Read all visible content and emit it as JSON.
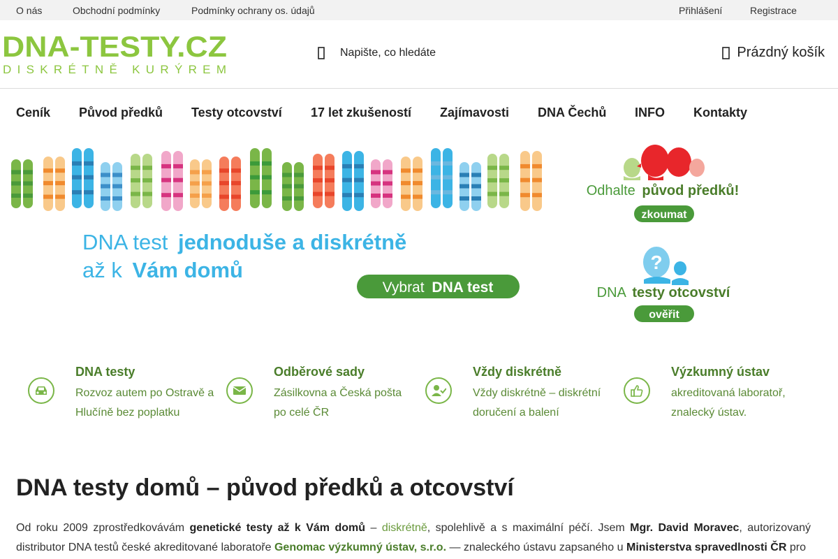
{
  "topbar": {
    "links": [
      "O nás",
      "Obchodní podmínky",
      "Podmínky ochrany os. údajů"
    ],
    "login": "Přihlášení",
    "register": "Registrace"
  },
  "header": {
    "logo_main": "DNA-TESTY.CZ",
    "logo_sub": "DISKRÉTNĚ KURÝREM",
    "search_placeholder": "Napište, co hledáte",
    "cart_label": "Prázdný košík"
  },
  "nav": {
    "items": [
      "Ceník",
      "Původ předků",
      "Testy otcovství",
      "17 let zkušeností",
      "Zajímavosti",
      "DNA Čechů",
      "INFO",
      "Kontakty"
    ]
  },
  "banner": {
    "headline_light_1": "DNA test",
    "headline_bold_1": "jednoduše a diskrétně",
    "headline_light_2": "až k",
    "headline_bold_2": "Vám domů",
    "cta_light": "Vybrat",
    "cta_bold": "DNA test",
    "promo1_light": "Odhalte",
    "promo1_bold": "původ předků!",
    "promo1_button": "zkoumat",
    "promo2_light": "DNA",
    "promo2_bold": "testy otcovství",
    "promo2_button": "ověřit"
  },
  "features": [
    {
      "icon": "car-icon",
      "title": "DNA testy",
      "desc": "Rozvoz autem po Ostravě a Hlučíně bez poplatku"
    },
    {
      "icon": "envelope-icon",
      "title": "Odběrové sady",
      "desc": "Zásilkovna a Česká pošta po celé ČR"
    },
    {
      "icon": "user-check-icon",
      "title": "Vždy diskrétně",
      "desc": "Vždy diskrétně – diskrétní doručení a balení"
    },
    {
      "icon": "thumbs-up-icon",
      "title": "Výzkumný ústav",
      "desc": "akreditovaná laboratoř, znalecký ústav."
    }
  ],
  "article": {
    "title": "DNA testy domů – původ předků a otcovství",
    "p_1": "Od roku 2009 zprostředkovávám",
    "p_2": "genetické testy až k Vám domů",
    "p_3": "–",
    "p_4": "diskrétně",
    "p_5": ", spolehlivě a s maximální péčí. Jsem",
    "p_6": "Mgr. David Moravec",
    "p_7": ", autorizovaný distributor DNA testů české akreditované laboratoře",
    "p_8": "Genomac výzkumný ústav, s.r.o.",
    "p_9": "— znaleckého ústavu zapsaného u",
    "p_10": "Ministerstva spravedlnosti ČR",
    "p_11": "pro"
  },
  "colors": {
    "brand_green": "#8cc63f",
    "dark_green": "#4a7d2a",
    "banner_blue": "#3cb4e5",
    "promo_red": "#e8262b"
  }
}
